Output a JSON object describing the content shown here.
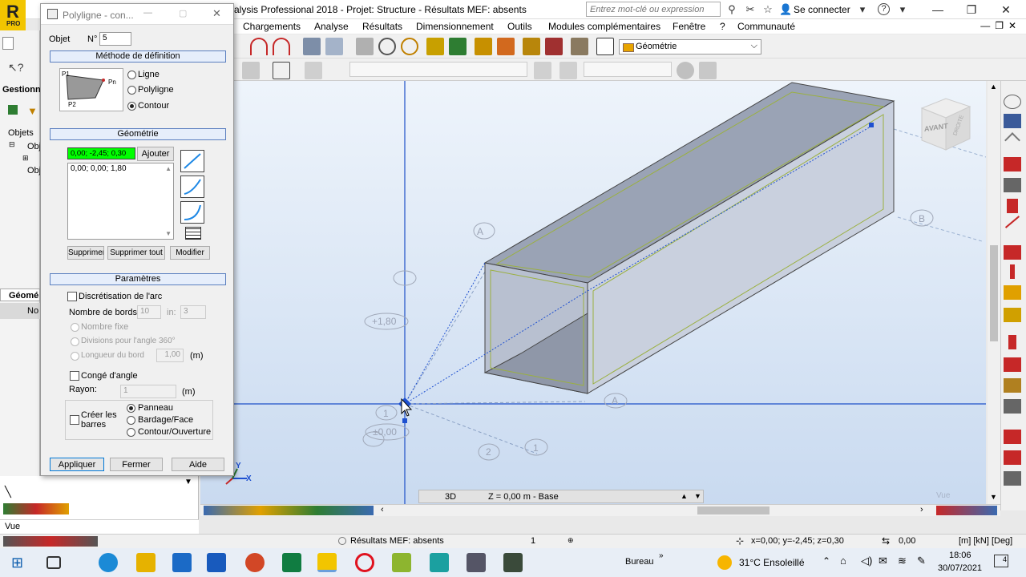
{
  "window": {
    "title": "alysis Professional 2018 - Projet: Structure - Résultats MEF: absents",
    "search_placeholder": "Entrez mot-clé ou expression",
    "login": "Se connecter",
    "logo_letter": "R",
    "logo_sub": "PRO"
  },
  "menu": [
    "Chargements",
    "Analyse",
    "Résultats",
    "Dimensionnement",
    "Outils",
    "Modules complémentaires",
    "Fenêtre",
    "?",
    "Communauté"
  ],
  "toolbar": {
    "geometry_select": "Géométrie"
  },
  "dialog": {
    "title": "Polyligne - con...",
    "object_label": "Objet",
    "object_no_label": "N°",
    "object_no": "5",
    "section_method": "Méthode de définition",
    "diagram_p1": "P1",
    "diagram_pn": "Pn",
    "diagram_p2": "P2",
    "method_options": [
      "Ligne",
      "Polyligne",
      "Contour"
    ],
    "method_selected": "Contour",
    "section_geometry": "Géométrie",
    "current_point": "0,00; -2,45; 0,30",
    "add_button": "Ajouter",
    "points": [
      "0,00; 0,00; 1,80"
    ],
    "delete_button": "Supprimer",
    "delete_all_button": "Supprimer tout",
    "modify_button": "Modifier",
    "section_params": "Paramètres",
    "arc_discretisation": "Discrétisation de l'arc",
    "nb_edges_label": "Nombre de bords:",
    "nb_edges_value": "10",
    "min_label": "in:",
    "min_value": "3",
    "fixed_number": "Nombre fixe",
    "divisions_label": "Divisions pour l'angle 360°",
    "edge_length_label": "Longueur du bord",
    "edge_length_value": "1,00",
    "edge_length_unit": "(m)",
    "fillet_label": "Congé d'angle",
    "radius_label": "Rayon:",
    "radius_value": "1",
    "radius_unit": "(m)",
    "create_bars_label": "Créer les barres",
    "create_options": [
      "Panneau",
      "Bardage/Face",
      "Contour/Ouverture"
    ],
    "create_selected": "Panneau",
    "apply_button": "Appliquer",
    "close_button": "Fermer",
    "help_button": "Aide"
  },
  "left_panel": {
    "title": "Gestionn",
    "tree_root": "Objets",
    "tree_items": [
      "Obj",
      "Obj"
    ],
    "geo_tab": "Géomé",
    "col_header": "No",
    "vue_label": "Vue"
  },
  "viewport": {
    "cube_front": "AVANT",
    "cube_right": "DROITE",
    "axis_labels": [
      "A",
      "B",
      "1",
      "2",
      "1",
      "A"
    ],
    "level_labels": [
      "+1,80",
      "±0,00"
    ],
    "axis_y": "Y",
    "axis_x": "X",
    "corner_label": "Vue"
  },
  "view_tabs": {
    "mode": "3D",
    "level": "Z = 0,00 m - Base"
  },
  "status": {
    "results": "Résultats MEF: absents",
    "count": "1",
    "coords": "x=0,00; y=-2,45; z=0,30",
    "value": "0,00",
    "units": "[m] [kN] [Deg]"
  },
  "taskbar": {
    "desktop": "Bureau",
    "weather": "31°C  Ensoleillé",
    "time": "18:06",
    "date": "30/07/2021",
    "notifications": "4"
  },
  "colors": {
    "accent": "#1565c0",
    "selection_green": "#00ff00",
    "viewport_top": "#eef4fb",
    "viewport_bottom": "#c9daf0"
  }
}
